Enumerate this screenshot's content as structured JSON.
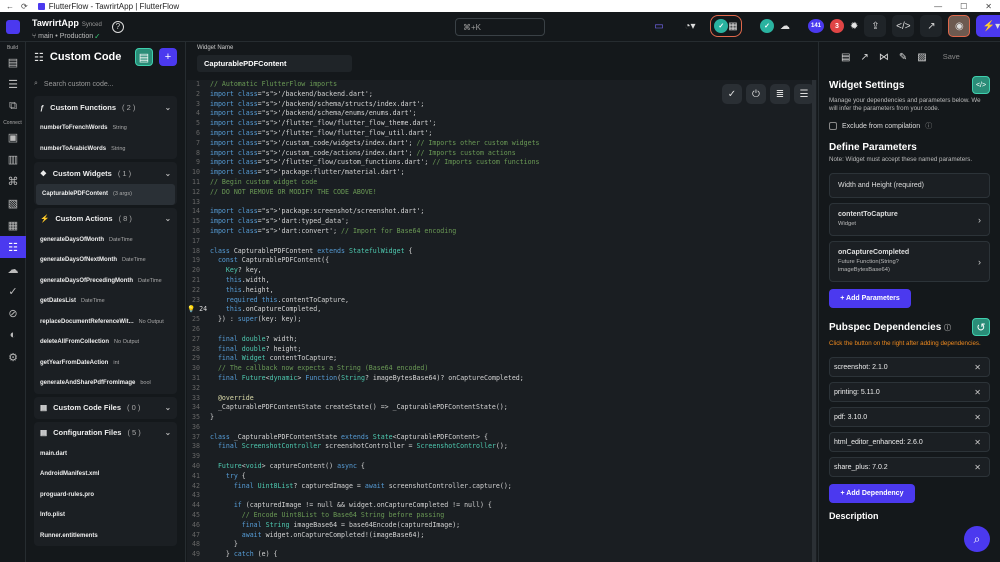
{
  "window": {
    "title": "FlutterFlow - TawrirtApp | FlutterFlow"
  },
  "topbar": {
    "app_name": "TawrirtApp",
    "sync_status": "Synced",
    "branch": "main",
    "environment": "Production",
    "search_shortcut": "⌘+K",
    "badges": {
      "issues": "141",
      "errors": "3"
    }
  },
  "sidebar": {
    "build_label": "Build",
    "connect_label": "Connect"
  },
  "panel": {
    "title": "Custom Code",
    "search_placeholder": "Search custom code...",
    "functions": {
      "title": "Custom Functions",
      "count": "( 2 )",
      "items": [
        {
          "name": "numberToFrenchWords",
          "type": "String"
        },
        {
          "name": "numberToArabicWords",
          "type": "String"
        }
      ]
    },
    "widgets": {
      "title": "Custom Widgets",
      "count": "( 1 )",
      "items": [
        {
          "name": "CapturablePDFContent",
          "type": "(3 args)"
        }
      ]
    },
    "actions": {
      "title": "Custom Actions",
      "count": "( 8 )",
      "items": [
        {
          "name": "generateDaysOfMonth",
          "type": "DateTime"
        },
        {
          "name": "generateDaysOfNextMonth",
          "type": "DateTime"
        },
        {
          "name": "generateDaysOfPrecedingMonth",
          "type": "DateTime"
        },
        {
          "name": "getDatesList",
          "type": "DateTime"
        },
        {
          "name": "replaceDocumentReferenceWit...",
          "type": "No Output"
        },
        {
          "name": "deleteAllFromCollection",
          "type": "No Output"
        },
        {
          "name": "getYearFromDateAction",
          "type": "int"
        },
        {
          "name": "generateAndSharePdfFromImage",
          "type": "bool"
        }
      ]
    },
    "files": {
      "title": "Custom Code Files",
      "count": "( 0 )"
    },
    "config": {
      "title": "Configuration Files",
      "count": "( 5 )",
      "items": [
        {
          "name": "main.dart"
        },
        {
          "name": "AndroidManifest.xml"
        },
        {
          "name": "proguard-rules.pro"
        },
        {
          "name": "Info.plist"
        },
        {
          "name": "Runner.entitlements"
        }
      ]
    }
  },
  "editor": {
    "widget_name_label": "Widget Name",
    "widget_name": "CapturablePDFContent",
    "highlight_line": 24,
    "lines": [
      "// Automatic FlutterFlow imports",
      "import '/backend/backend.dart';",
      "import '/backend/schema/structs/index.dart';",
      "import '/backend/schema/enums/enums.dart';",
      "import '/flutter_flow/flutter_flow_theme.dart';",
      "import '/flutter_flow/flutter_flow_util.dart';",
      "import '/custom_code/widgets/index.dart'; // Imports other custom widgets",
      "import '/custom_code/actions/index.dart'; // Imports custom actions",
      "import '/flutter_flow/custom_functions.dart'; // Imports custom functions",
      "import 'package:flutter/material.dart';",
      "// Begin custom widget code",
      "// DO NOT REMOVE OR MODIFY THE CODE ABOVE!",
      "",
      "import 'package:screenshot/screenshot.dart';",
      "import 'dart:typed_data';",
      "import 'dart:convert'; // Import for Base64 encoding",
      "",
      "class CapturablePDFContent extends StatefulWidget {",
      "  const CapturablePDFContent({",
      "    Key? key,",
      "    this.width,",
      "    this.height,",
      "    required this.contentToCapture,",
      "    this.onCaptureCompleted,",
      "  }) : super(key: key);",
      "",
      "  final double? width;",
      "  final double? height;",
      "  final Widget contentToCapture;",
      "  // The callback now expects a String (Base64 encoded)",
      "  final Future<dynamic> Function(String? imageBytesBase64)? onCaptureCompleted;",
      "",
      "  @override",
      "  _CapturablePDFContentState createState() => _CapturablePDFContentState();",
      "}",
      "",
      "class _CapturablePDFContentState extends State<CapturablePDFContent> {",
      "  final ScreenshotController screenshotController = ScreenshotController();",
      "",
      "  Future<void> captureContent() async {",
      "    try {",
      "      final Uint8List? capturedImage = await screenshotController.capture();",
      "",
      "      if (capturedImage != null && widget.onCaptureCompleted != null) {",
      "        // Encode Uint8List to Base64 String before passing",
      "        final String imageBase64 = base64Encode(capturedImage);",
      "        await widget.onCaptureCompleted!(imageBase64);",
      "      }",
      "    } catch (e) {"
    ]
  },
  "right": {
    "save_label": "Save",
    "settings_title": "Widget Settings",
    "settings_desc": "Manage your dependencies and parameters below. We will infer the parameters from your code.",
    "exclude_label": "Exclude from compilation",
    "define_title": "Define Parameters",
    "define_note": "Note: Widget must accept these named parameters.",
    "width_height": "Width and Height (required)",
    "params": [
      {
        "name": "contentToCapture",
        "type": "Widget"
      },
      {
        "name": "onCaptureCompleted",
        "type": "Future Function(String? imageBytesBase64)"
      }
    ],
    "add_param_label": "+ Add Parameters",
    "pubspec_title": "Pubspec Dependencies",
    "pubspec_warn": "Click the button on the right after adding dependencies.",
    "deps": [
      "screenshot: 2.1.0",
      "printing: 5.11.0",
      "pdf: 3.10.0",
      "html_editor_enhanced: 2.6.0",
      "share_plus: 7.0.2"
    ],
    "add_dep_label": "+ Add Dependency",
    "description_title": "Description"
  }
}
